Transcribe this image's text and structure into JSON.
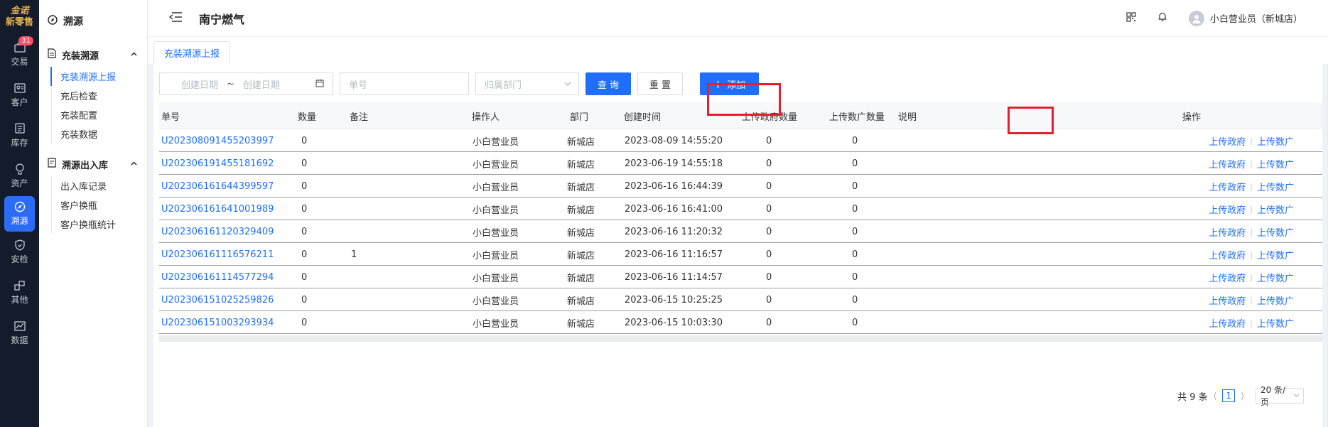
{
  "brand": {
    "line1": "金诺",
    "line2": "新零售"
  },
  "rail": [
    {
      "label": "交易",
      "icon": "trade-icon",
      "badge": "31"
    },
    {
      "label": "客户",
      "icon": "customer-icon"
    },
    {
      "label": "库存",
      "icon": "inventory-icon"
    },
    {
      "label": "资产",
      "icon": "asset-icon"
    },
    {
      "label": "溯源",
      "icon": "compass-icon",
      "active": true
    },
    {
      "label": "安检",
      "icon": "shield-icon"
    },
    {
      "label": "其他",
      "icon": "other-icon"
    },
    {
      "label": "数据",
      "icon": "chart-icon"
    }
  ],
  "submenu": {
    "title": "溯源",
    "groups": [
      {
        "label": "充装溯源",
        "items": [
          "充装溯源上报",
          "充后检查",
          "充装配置",
          "充装数据"
        ]
      },
      {
        "label": "溯源出入库",
        "items": [
          "出入库记录",
          "客户换瓶",
          "客户换瓶统计"
        ]
      }
    ]
  },
  "header": {
    "title": "南宁燃气",
    "user": "小白营业员（新城店）"
  },
  "tab": {
    "label": "充装溯源上报"
  },
  "filters": {
    "date_start_placeholder": "创建日期",
    "date_sep": "~",
    "date_end_placeholder": "创建日期",
    "order_placeholder": "单号",
    "dept_placeholder": "归属部门",
    "query_label": "查 询",
    "reset_label": "重 置",
    "add_label": "添加"
  },
  "table": {
    "columns": [
      "单号",
      "数量",
      "备注",
      "操作人",
      "部门",
      "创建时间",
      "上传政府数量",
      "上传数广数量",
      "说明",
      "操作"
    ],
    "rows": [
      {
        "id": "U202308091455203997",
        "qty": "0",
        "note": "",
        "operator": "小白营业员",
        "dept": "新城店",
        "time": "2023-08-09 14:55:20",
        "gov": "0",
        "sg": "0",
        "desc": ""
      },
      {
        "id": "U202306191455181692",
        "qty": "0",
        "note": "",
        "operator": "小白营业员",
        "dept": "新城店",
        "time": "2023-06-19 14:55:18",
        "gov": "0",
        "sg": "0",
        "desc": ""
      },
      {
        "id": "U202306161644399597",
        "qty": "0",
        "note": "",
        "operator": "小白营业员",
        "dept": "新城店",
        "time": "2023-06-16 16:44:39",
        "gov": "0",
        "sg": "0",
        "desc": ""
      },
      {
        "id": "U202306161641001989",
        "qty": "0",
        "note": "",
        "operator": "小白营业员",
        "dept": "新城店",
        "time": "2023-06-16 16:41:00",
        "gov": "0",
        "sg": "0",
        "desc": ""
      },
      {
        "id": "U202306161120329409",
        "qty": "0",
        "note": "",
        "operator": "小白营业员",
        "dept": "新城店",
        "time": "2023-06-16 11:20:32",
        "gov": "0",
        "sg": "0",
        "desc": ""
      },
      {
        "id": "U202306161116576211",
        "qty": "0",
        "note": "1",
        "operator": "小白营业员",
        "dept": "新城店",
        "time": "2023-06-16 11:16:57",
        "gov": "0",
        "sg": "0",
        "desc": ""
      },
      {
        "id": "U202306161114577294",
        "qty": "0",
        "note": "",
        "operator": "小白营业员",
        "dept": "新城店",
        "time": "2023-06-16 11:14:57",
        "gov": "0",
        "sg": "0",
        "desc": ""
      },
      {
        "id": "U202306151025259826",
        "qty": "0",
        "note": "",
        "operator": "小白营业员",
        "dept": "新城店",
        "time": "2023-06-15 10:25:25",
        "gov": "0",
        "sg": "0",
        "desc": ""
      },
      {
        "id": "U202306151003293934",
        "qty": "0",
        "note": "",
        "operator": "小白营业员",
        "dept": "新城店",
        "time": "2023-06-15 10:03:30",
        "gov": "0",
        "sg": "0",
        "desc": ""
      }
    ],
    "op_gov": "上传政府",
    "op_sg": "上传数广"
  },
  "pagination": {
    "total": "共 9 条",
    "current": "1",
    "page_size": "20 条/页"
  },
  "colors": {
    "primary": "#1f6fff",
    "rail_bg": "#141c2c",
    "highlight": "#e5202e"
  }
}
